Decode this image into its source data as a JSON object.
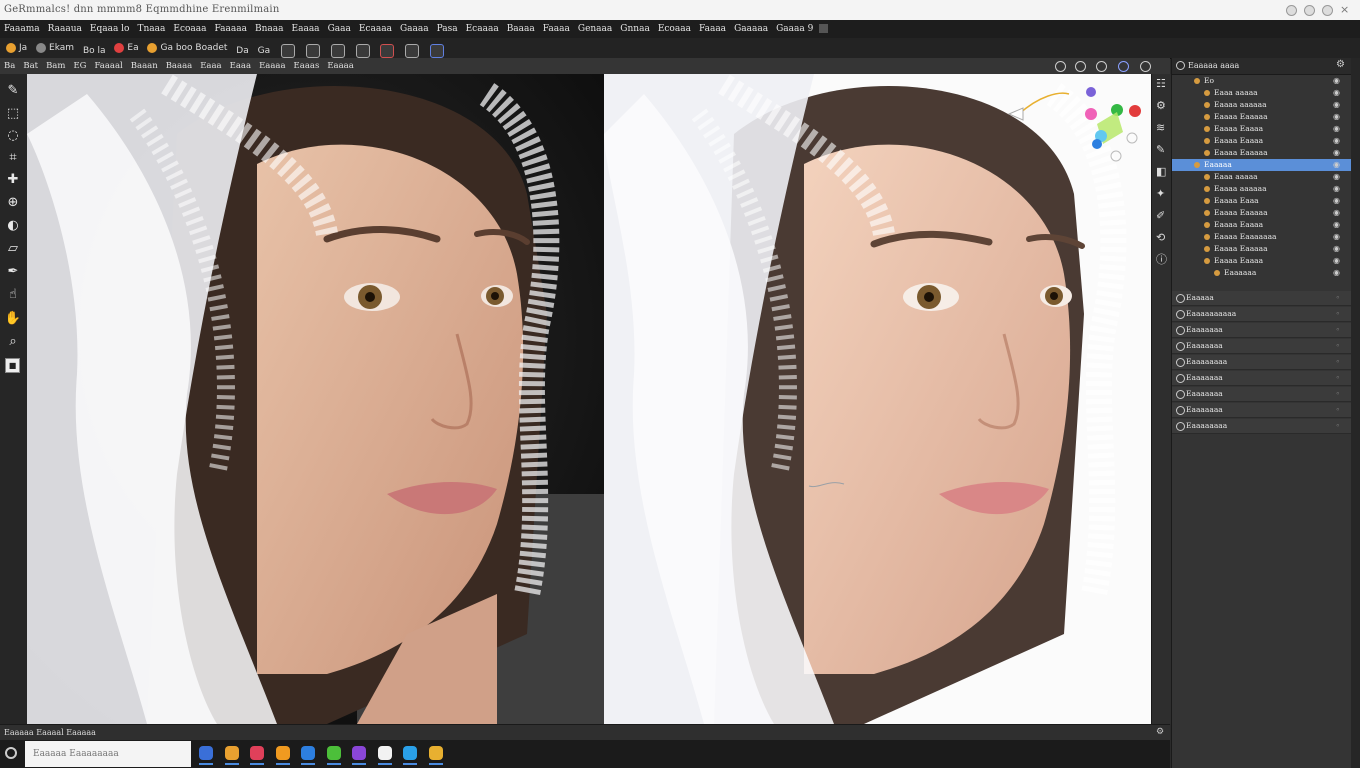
{
  "window": {
    "title": "GeRmmalcs! dnn mmmm8 Eqmmdhine Erenmilmain"
  },
  "menubar": {
    "items": [
      "Faaama",
      "Raaaua",
      "Eqaaa lo",
      "Tnaaa",
      "Ecoaaa",
      "Faaaaa",
      "Bnaaa",
      "Eaaaa",
      "Gaaa",
      "Ecaaaa",
      "Gaaaa",
      "Pasa",
      "Ecaaaa",
      "Baaaa",
      "Faaaa",
      "Genaaa",
      "Gnnaa",
      "Ecoaaa",
      "Faaaa",
      "Gaaaaa",
      "Gaaaa 9"
    ]
  },
  "optionsbar": {
    "items": [
      "Ja",
      "Ekam",
      "Bo la",
      "Ea",
      "Ga boo Boadet",
      "Da",
      "Ga"
    ]
  },
  "doctabs": {
    "items": [
      "Ba",
      "Bat",
      "Bam",
      "EG",
      "Faaaal",
      "Baaan",
      "Baaaa",
      "Eaaa",
      "Eaaa",
      "Eaaaa",
      "Eaaas",
      "Eaaaa"
    ]
  },
  "toolbox": {
    "icons": [
      "brush-tool-icon",
      "selection-tool-icon",
      "lasso-tool-icon",
      "crop-tool-icon",
      "heal-tool-icon",
      "clone-tool-icon",
      "dodge-tool-icon",
      "eraser-tool-icon",
      "pen-tool-icon",
      "smudge-tool-icon",
      "hand-tool-icon",
      "zoom-tool-icon",
      "color-swatch-icon"
    ]
  },
  "canvas": {
    "left_label": "before-image",
    "right_label": "after-image"
  },
  "panel": {
    "title": "Eaaaaa aaaa",
    "layers": [
      {
        "label": "Eo",
        "indent": 1
      },
      {
        "label": "Eaaa aaaaa",
        "indent": 2
      },
      {
        "label": "Eaaaa aaaaaa",
        "indent": 2
      },
      {
        "label": "Eaaaa Eaaaaa",
        "indent": 2
      },
      {
        "label": "Eaaaa Eaaaa",
        "indent": 2
      },
      {
        "label": "Eaaaa Eaaaa",
        "indent": 2
      },
      {
        "label": "Eaaaa Eaaaaa",
        "indent": 2
      },
      {
        "label": "Eaaaaa",
        "indent": 1,
        "selected": true
      },
      {
        "label": "Eaaa aaaaa",
        "indent": 2
      },
      {
        "label": "Eaaaa aaaaaa",
        "indent": 2
      },
      {
        "label": "Eaaaa Eaaa",
        "indent": 2
      },
      {
        "label": "Eaaaa Eaaaaa",
        "indent": 2
      },
      {
        "label": "Eaaaa Eaaaa",
        "indent": 2
      },
      {
        "label": "Eaaaa Eaaaaaaa",
        "indent": 2
      },
      {
        "label": "Eaaaa Eaaaaa",
        "indent": 2
      },
      {
        "label": "Eaaaa Eaaaa",
        "indent": 2
      },
      {
        "label": "Eaaaaaa",
        "indent": 3
      }
    ],
    "sections": [
      "Eaaaaa",
      "Eaaaaaaaaaa",
      "Eaaaaaaa",
      "Eaaaaaaa",
      "Eaaaaaaaa",
      "Eaaaaaaa",
      "Eaaaaaaa",
      "Eaaaaaaa",
      "Eaaaaaaaa"
    ]
  },
  "statusbar": {
    "text": "Eaaaaa Eaaaal Eaaaaa"
  },
  "taskbar": {
    "search_placeholder": "Eaaaaa Eaaaaaaaa",
    "apps": [
      {
        "name": "app-1-icon",
        "color": "#3a6fd8"
      },
      {
        "name": "app-2-icon",
        "color": "#e8a030"
      },
      {
        "name": "app-3-icon",
        "color": "#e0405a"
      },
      {
        "name": "app-4-icon",
        "color": "#f09a20"
      },
      {
        "name": "app-5-icon",
        "color": "#2d7fe0"
      },
      {
        "name": "app-6-icon",
        "color": "#4cbf3a"
      },
      {
        "name": "app-7-icon",
        "color": "#8a46d8"
      },
      {
        "name": "app-8-icon",
        "color": "#f2f2f2"
      },
      {
        "name": "app-9-icon",
        "color": "#2aa0e8"
      },
      {
        "name": "app-10-icon",
        "color": "#e8b030"
      }
    ]
  },
  "colors": {
    "accent": "#5b8fd8",
    "panel_bg": "#343434",
    "menubar_bg": "#1d1d1d"
  }
}
